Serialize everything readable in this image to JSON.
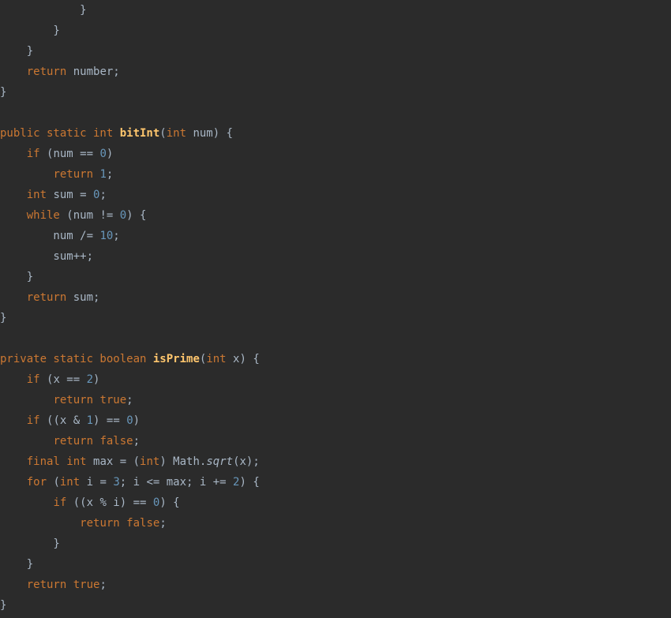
{
  "code": {
    "lines": [
      [
        {
          "cls": "p",
          "txt": "            }"
        }
      ],
      [
        {
          "cls": "p",
          "txt": "        }"
        }
      ],
      [
        {
          "cls": "p",
          "txt": "    }"
        }
      ],
      [
        {
          "cls": "p",
          "txt": "    "
        },
        {
          "cls": "kw",
          "txt": "return "
        },
        {
          "cls": "p",
          "txt": "number;"
        }
      ],
      [
        {
          "cls": "p",
          "txt": "}"
        }
      ],
      [
        {
          "cls": "p",
          "txt": ""
        }
      ],
      [
        {
          "cls": "kw",
          "txt": "public static int "
        },
        {
          "cls": "fnB",
          "txt": "bitInt"
        },
        {
          "cls": "p",
          "txt": "("
        },
        {
          "cls": "kw",
          "txt": "int "
        },
        {
          "cls": "p",
          "txt": "num) {"
        }
      ],
      [
        {
          "cls": "p",
          "txt": "    "
        },
        {
          "cls": "kw",
          "txt": "if "
        },
        {
          "cls": "p",
          "txt": "(num == "
        },
        {
          "cls": "num",
          "txt": "0"
        },
        {
          "cls": "p",
          "txt": ")"
        }
      ],
      [
        {
          "cls": "p",
          "txt": "        "
        },
        {
          "cls": "kw",
          "txt": "return "
        },
        {
          "cls": "num",
          "txt": "1"
        },
        {
          "cls": "p",
          "txt": ";"
        }
      ],
      [
        {
          "cls": "p",
          "txt": "    "
        },
        {
          "cls": "kw",
          "txt": "int "
        },
        {
          "cls": "p",
          "txt": "sum = "
        },
        {
          "cls": "num",
          "txt": "0"
        },
        {
          "cls": "p",
          "txt": ";"
        }
      ],
      [
        {
          "cls": "p",
          "txt": "    "
        },
        {
          "cls": "kw",
          "txt": "while "
        },
        {
          "cls": "p",
          "txt": "(num != "
        },
        {
          "cls": "num",
          "txt": "0"
        },
        {
          "cls": "p",
          "txt": ") {"
        }
      ],
      [
        {
          "cls": "p",
          "txt": "        num /= "
        },
        {
          "cls": "num",
          "txt": "10"
        },
        {
          "cls": "p",
          "txt": ";"
        }
      ],
      [
        {
          "cls": "p",
          "txt": "        sum++;"
        }
      ],
      [
        {
          "cls": "p",
          "txt": "    }"
        }
      ],
      [
        {
          "cls": "p",
          "txt": "    "
        },
        {
          "cls": "kw",
          "txt": "return "
        },
        {
          "cls": "p",
          "txt": "sum;"
        }
      ],
      [
        {
          "cls": "p",
          "txt": "}"
        }
      ],
      [
        {
          "cls": "p",
          "txt": ""
        }
      ],
      [
        {
          "cls": "kw",
          "txt": "private static boolean "
        },
        {
          "cls": "fnB",
          "txt": "isPrime"
        },
        {
          "cls": "p",
          "txt": "("
        },
        {
          "cls": "kw",
          "txt": "int "
        },
        {
          "cls": "p",
          "txt": "x) {"
        }
      ],
      [
        {
          "cls": "p",
          "txt": "    "
        },
        {
          "cls": "kw",
          "txt": "if "
        },
        {
          "cls": "p",
          "txt": "(x == "
        },
        {
          "cls": "num",
          "txt": "2"
        },
        {
          "cls": "p",
          "txt": ")"
        }
      ],
      [
        {
          "cls": "p",
          "txt": "        "
        },
        {
          "cls": "kw",
          "txt": "return true"
        },
        {
          "cls": "p",
          "txt": ";"
        }
      ],
      [
        {
          "cls": "p",
          "txt": "    "
        },
        {
          "cls": "kw",
          "txt": "if "
        },
        {
          "cls": "p",
          "txt": "((x & "
        },
        {
          "cls": "num",
          "txt": "1"
        },
        {
          "cls": "p",
          "txt": ") == "
        },
        {
          "cls": "num",
          "txt": "0"
        },
        {
          "cls": "p",
          "txt": ")"
        }
      ],
      [
        {
          "cls": "p",
          "txt": "        "
        },
        {
          "cls": "kw",
          "txt": "return false"
        },
        {
          "cls": "p",
          "txt": ";"
        }
      ],
      [
        {
          "cls": "p",
          "txt": "    "
        },
        {
          "cls": "kw",
          "txt": "final int "
        },
        {
          "cls": "p",
          "txt": "max = ("
        },
        {
          "cls": "kw",
          "txt": "int"
        },
        {
          "cls": "p",
          "txt": ") Math."
        },
        {
          "cls": "ital",
          "txt": "sqrt"
        },
        {
          "cls": "p",
          "txt": "(x);"
        }
      ],
      [
        {
          "cls": "p",
          "txt": "    "
        },
        {
          "cls": "kw",
          "txt": "for "
        },
        {
          "cls": "p",
          "txt": "("
        },
        {
          "cls": "kw",
          "txt": "int "
        },
        {
          "cls": "p",
          "txt": "i = "
        },
        {
          "cls": "num",
          "txt": "3"
        },
        {
          "cls": "p",
          "txt": "; i <= max; i += "
        },
        {
          "cls": "num",
          "txt": "2"
        },
        {
          "cls": "p",
          "txt": ") {"
        }
      ],
      [
        {
          "cls": "p",
          "txt": "        "
        },
        {
          "cls": "kw",
          "txt": "if "
        },
        {
          "cls": "p",
          "txt": "((x % i) == "
        },
        {
          "cls": "num",
          "txt": "0"
        },
        {
          "cls": "p",
          "txt": ") {"
        }
      ],
      [
        {
          "cls": "p",
          "txt": "            "
        },
        {
          "cls": "kw",
          "txt": "return false"
        },
        {
          "cls": "p",
          "txt": ";"
        }
      ],
      [
        {
          "cls": "p",
          "txt": "        }"
        }
      ],
      [
        {
          "cls": "p",
          "txt": "    }"
        }
      ],
      [
        {
          "cls": "p",
          "txt": "    "
        },
        {
          "cls": "kw",
          "txt": "return true"
        },
        {
          "cls": "p",
          "txt": ";"
        }
      ],
      [
        {
          "cls": "p",
          "txt": "}"
        }
      ]
    ]
  }
}
